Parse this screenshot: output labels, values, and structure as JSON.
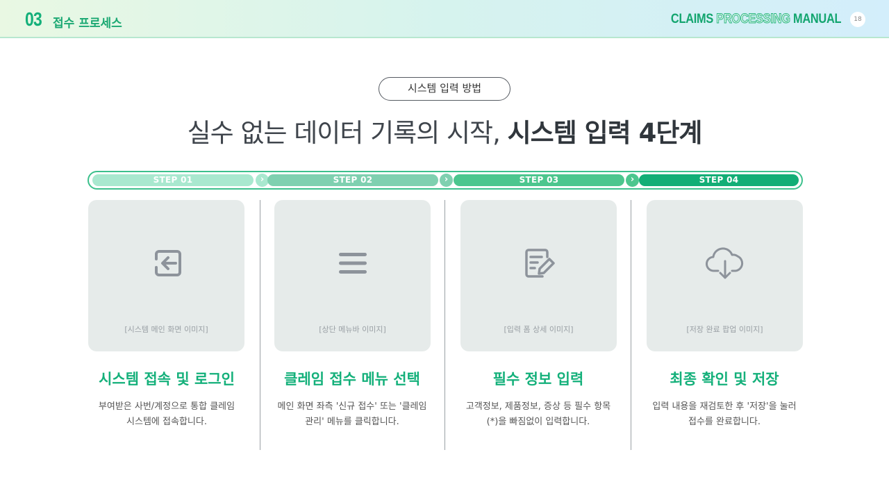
{
  "header": {
    "section_number": "03",
    "section_title": "접수 프로세스",
    "manual_word1": "CLAIMS",
    "manual_word2": "PROCESSING",
    "manual_word3": "MANUAL",
    "page_number": "18"
  },
  "pill_label": "시스템 입력 방법",
  "headline": {
    "plain": "실수 없는 데이터 기록의 시작, ",
    "bold": "시스템 입력 4단계"
  },
  "steps": [
    {
      "label": "STEP 01",
      "color": "#a9e8cf",
      "image_caption": "[시스템 메인 화면 이미지]",
      "icon": "sign-in-icon",
      "title": "시스템 접속 및 로그인",
      "desc_line1": "부여받은 사번/계정으로 통합 클레임",
      "desc_line2": "시스템에 접속합니다."
    },
    {
      "label": "STEP 02",
      "color": "#7fd0b0",
      "image_caption": "[상단 메뉴바 이미지]",
      "icon": "menu-icon",
      "title": "클레임 접수 메뉴 선택",
      "desc_line1": "메인 화면 좌측 '신규 접수' 또는 '클레임",
      "desc_line2": "관리' 메뉴를 클릭합니다."
    },
    {
      "label": "STEP 03",
      "color": "#4cc68e",
      "image_caption": "[입력 폼 상세 이미지]",
      "icon": "edit-document-icon",
      "title": "필수 정보 입력",
      "desc_line1": "고객정보, 제품정보, 증상 등 필수 항목",
      "desc_line2": "(*)을 빠짐없이 입력합니다."
    },
    {
      "label": "STEP 04",
      "color": "#12ae76",
      "image_caption": "[저장 완료 팝업 이미지]",
      "icon": "cloud-download-icon",
      "title": "최종 확인 및 저장",
      "desc_line1": "입력 내용을 재검토한 후 '저장'을 눌러",
      "desc_line2": "접수를 완료합니다."
    }
  ],
  "chevron_glyph": "›"
}
